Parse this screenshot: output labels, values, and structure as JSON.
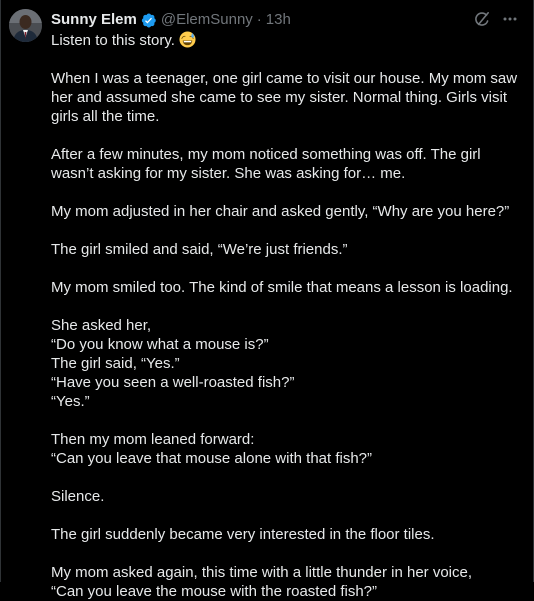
{
  "author": {
    "name": "Sunny Elem",
    "handle": "@ElemSunny",
    "separator": "·",
    "time": "13h",
    "verified_color": "#1d9bf0"
  },
  "actions": {
    "grok_icon": "grok-icon",
    "more_icon": "more-icon"
  },
  "post": {
    "intro": "Listen to this story.",
    "intro_emoji": "grinning-sweat-face",
    "paragraphs": [
      "When I was a teenager, one girl came to visit our house. My mom saw her and assumed she came to see my sister. Normal thing. Girls visit girls all the time.",
      "After a few minutes, my mom noticed something was off. The girl wasn’t asking for my sister. She was asking for… me.",
      "My mom adjusted in her chair and asked gently, “Why are you here?”",
      "The girl smiled and said, “We’re just friends.”",
      "My mom smiled too. The kind of smile that means a lesson is loading.",
      "She asked her,\n“Do you know what a mouse is?”\nThe girl said, “Yes.”\n“Have you seen a well-roasted fish?”\n“Yes.”",
      "Then my mom leaned forward:\n“Can you leave that mouse alone with that fish?”",
      "Silence.",
      "The girl suddenly became very interested in the floor tiles.",
      "My mom asked again, this time with a little thunder in her voice,\n“Can you leave the mouse with the roasted fish?”"
    ]
  },
  "colors": {
    "background": "#000000",
    "text": "#e7e9ea",
    "muted": "#71767b",
    "border": "#2f3336",
    "accent": "#1d9bf0"
  }
}
